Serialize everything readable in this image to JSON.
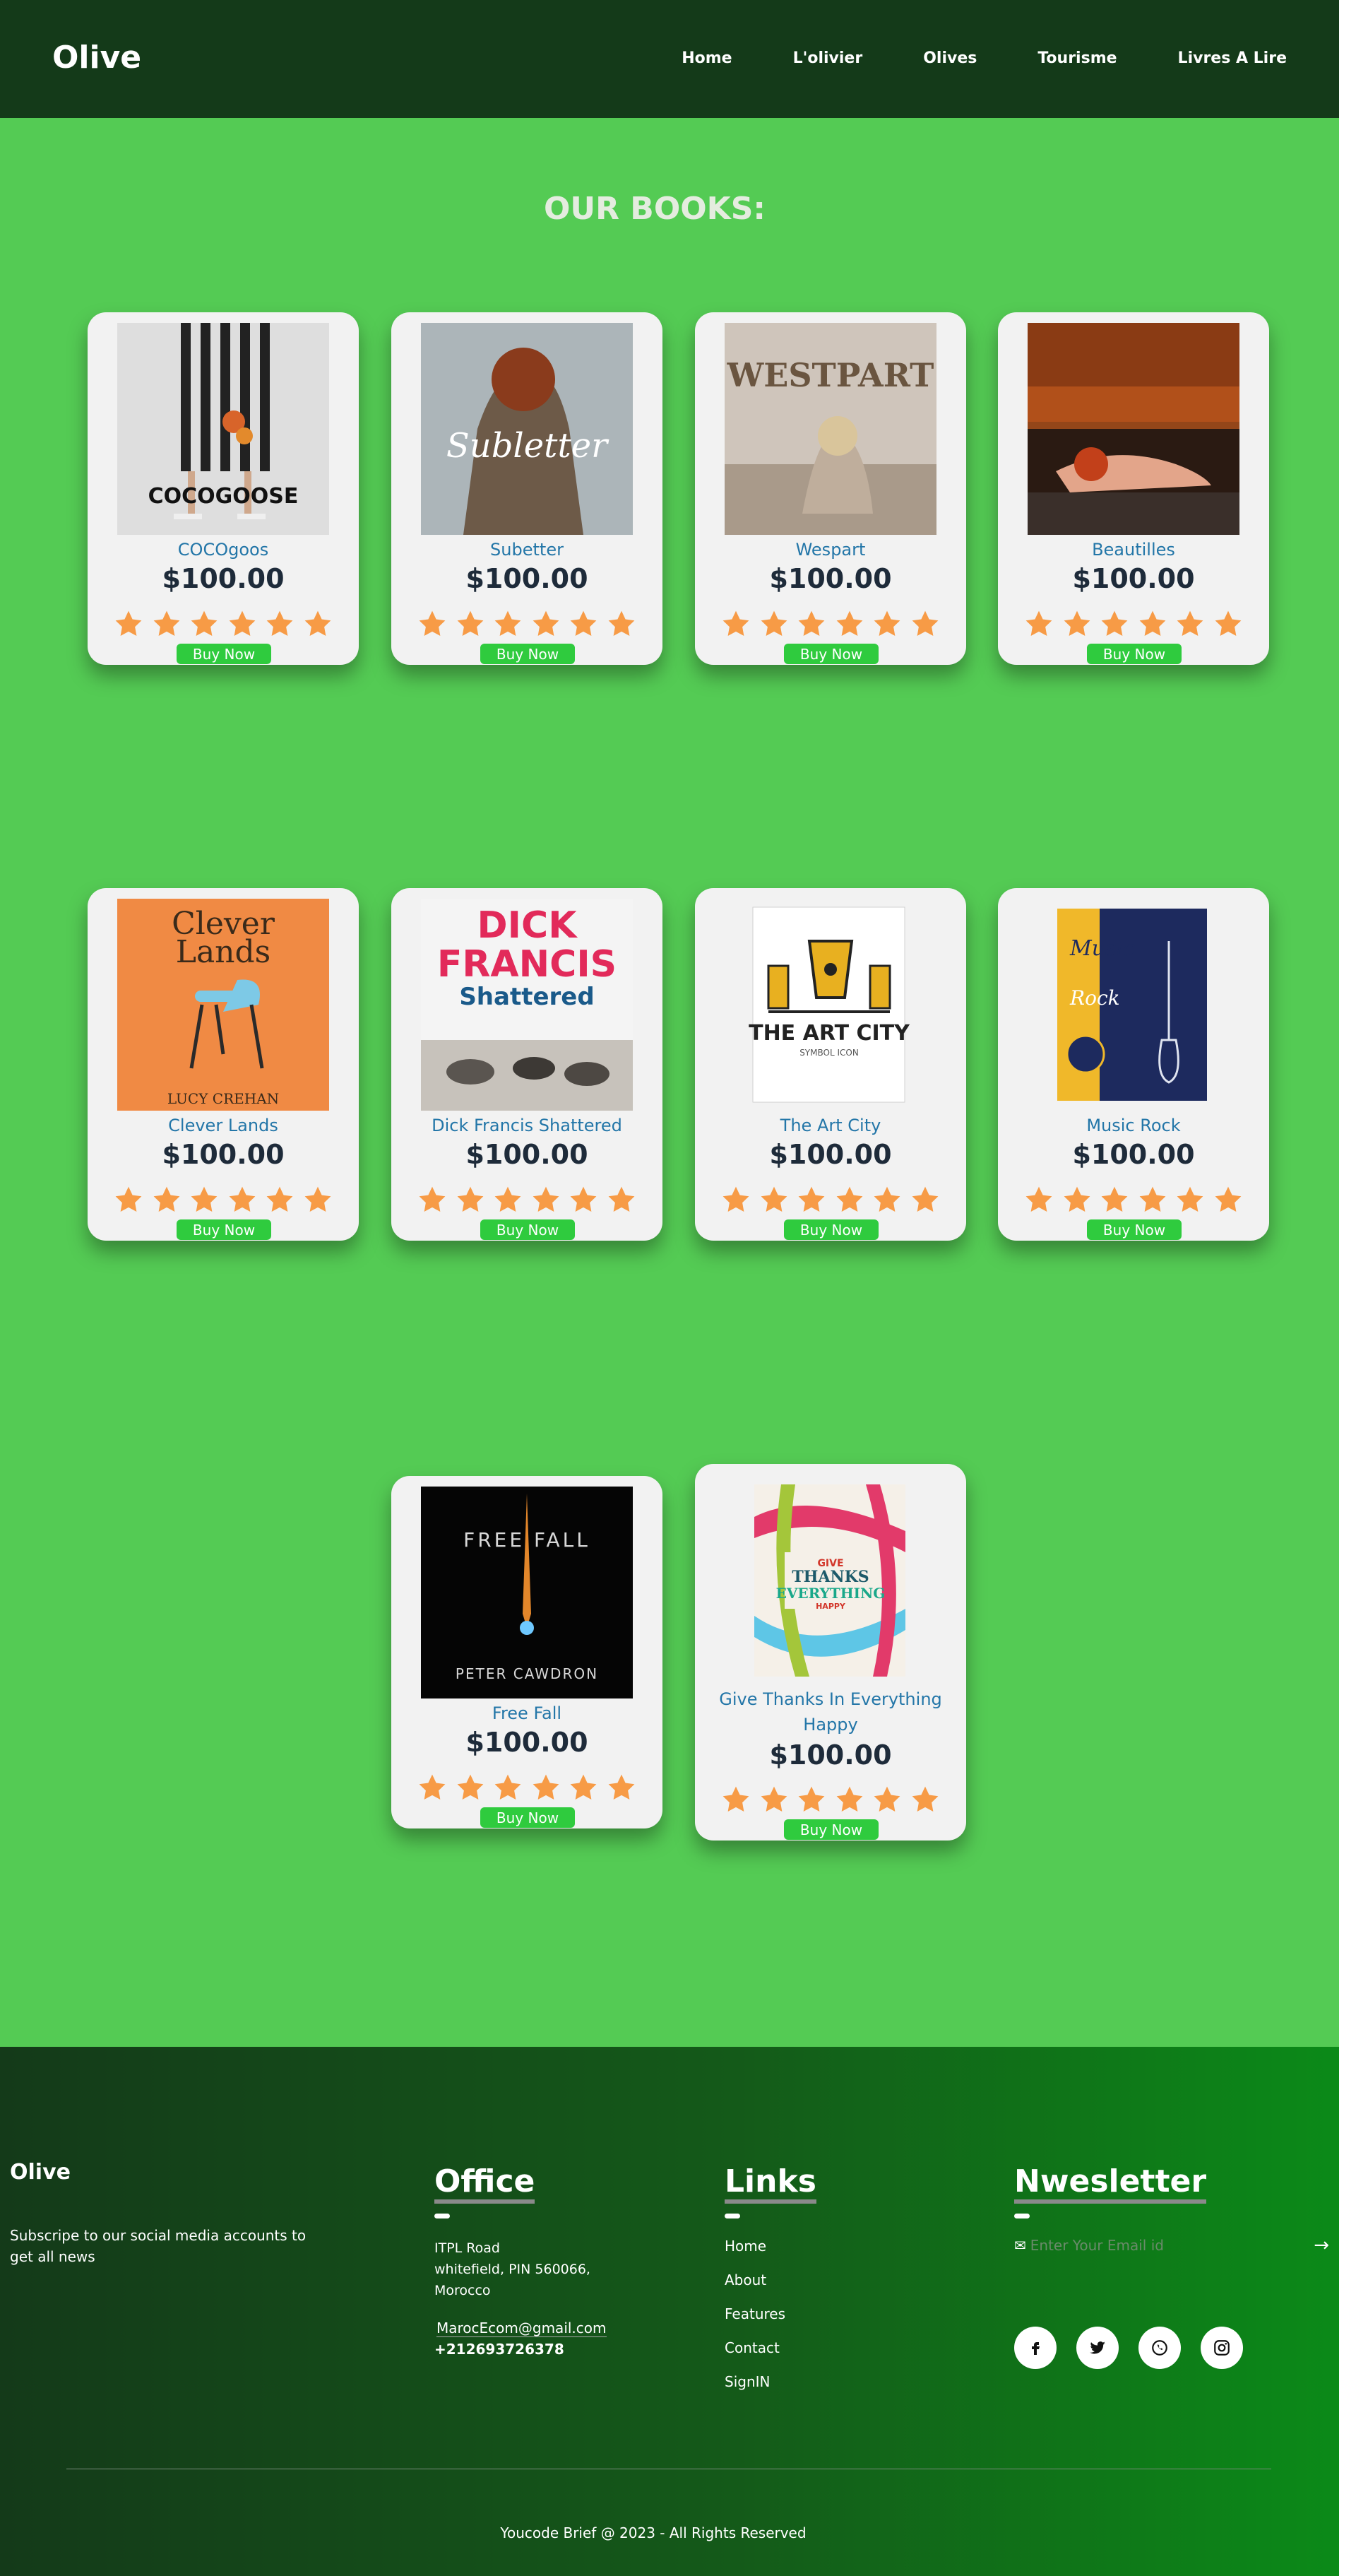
{
  "nav": {
    "brand": "Olive",
    "items": [
      "Home",
      "L'olivier",
      "Olives",
      "Tourisme",
      "Livres A Lire"
    ]
  },
  "heading": "OUR BOOKS:",
  "books": [
    {
      "title": "COCOgoos",
      "price": "$100.00",
      "rating": 6,
      "buy_label": "Buy Now",
      "cover_text": "COCOGOOSE"
    },
    {
      "title": "Subetter",
      "price": "$100.00",
      "rating": 6,
      "buy_label": "Buy Now",
      "cover_text": "Subletter"
    },
    {
      "title": "Wespart",
      "price": "$100.00",
      "rating": 6,
      "buy_label": "Buy Now",
      "cover_text": "WESTPART"
    },
    {
      "title": "Beautilles",
      "price": "$100.00",
      "rating": 6,
      "buy_label": "Buy Now",
      "cover_text": ""
    },
    {
      "title": "Clever Lands",
      "price": "$100.00",
      "rating": 6,
      "buy_label": "Buy Now",
      "cover_text": "Clever Lands",
      "cover_author": "LUCY CREHAN"
    },
    {
      "title": "Dick Francis Shattered",
      "price": "$100.00",
      "rating": 6,
      "buy_label": "Buy Now",
      "cover_text": "DICK FRANCIS",
      "cover_sub": "Shattered"
    },
    {
      "title": "The Art City",
      "price": "$100.00",
      "rating": 6,
      "buy_label": "Buy Now",
      "cover_text": "THE ART CITY",
      "cover_sub": "SYMBOL ICON"
    },
    {
      "title": "Music Rock",
      "price": "$100.00",
      "rating": 6,
      "buy_label": "Buy Now",
      "cover_text": "Music",
      "cover_sub": "Rock"
    },
    {
      "title": "Free Fall",
      "price": "$100.00",
      "rating": 6,
      "buy_label": "Buy Now",
      "cover_text": "FREE FALL",
      "cover_author": "PETER CAWDRON"
    },
    {
      "title": "Give Thanks In Everything Happy",
      "price": "$100.00",
      "rating": 6,
      "buy_label": "Buy Now",
      "cover_text": "GIVE THANKS IN EVERYTHING",
      "cover_sub": "HAPPY"
    }
  ],
  "footer": {
    "brand": "Olive",
    "subscribe_text": "Subscripe to our social media accounts to get all news",
    "office_title": "Office",
    "office_address": [
      "ITPL Road",
      "whitefield, PIN 560066,",
      "Morocco"
    ],
    "office_email": "MarocEcom@gmail.com",
    "office_phone": "+212693726378",
    "links_title": "Links",
    "links": [
      "Home",
      "About",
      "Features",
      "Contact",
      "SignIN"
    ],
    "newsletter_title": "Nwesletter",
    "email_placeholder": "Enter Your Email id",
    "socials": [
      "facebook-icon",
      "twitter-icon",
      "whatsapp-icon",
      "instagram-icon"
    ],
    "copyright": "Youcode Brief @ 2023 - All Rights Reserved"
  },
  "colors": {
    "nav_bg": "#143a19",
    "page_bg": "#54cb54",
    "card_bg": "#f2f2f2",
    "title_blue": "#2376a8",
    "star_orange": "#f79b46",
    "buy_green": "#2fcb3e"
  }
}
